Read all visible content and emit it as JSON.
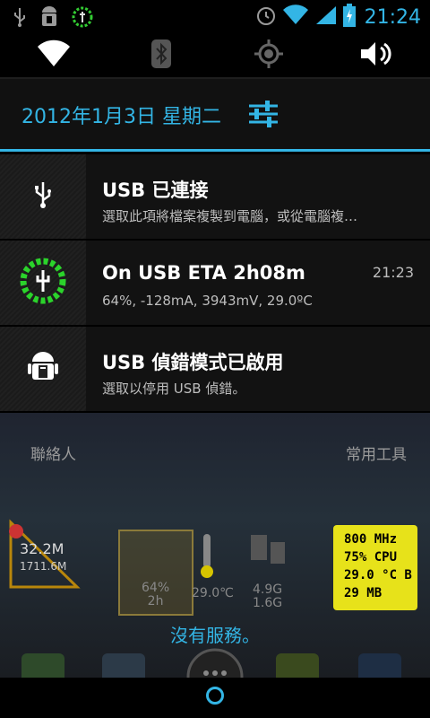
{
  "status_bar": {
    "time": "21:24",
    "left_icons": [
      "usb-icon",
      "android-debug-icon",
      "battery-widget-icon"
    ],
    "right_icons": [
      "alarm-icon",
      "wifi-icon",
      "signal-icon",
      "battery-charging-icon"
    ]
  },
  "quick_settings": {
    "items": [
      {
        "icon": "wifi-icon"
      },
      {
        "icon": "bluetooth-icon"
      },
      {
        "icon": "gps-icon"
      },
      {
        "icon": "volume-icon"
      }
    ]
  },
  "header": {
    "date": "2012年1月3日 星期二"
  },
  "notifications": [
    {
      "icon": "usb-icon",
      "title": "USB 已連接",
      "subtitle": "選取此項將檔案複製到電腦，或從電腦複…",
      "time": ""
    },
    {
      "icon": "battery-charge-ring-icon",
      "title": "On USB ETA 2h08m",
      "subtitle": "64%, -128mA, 3943mV, 29.0ºC",
      "time": "21:23"
    },
    {
      "icon": "android-debug-icon",
      "title": "USB 偵錯模式已啟用",
      "subtitle": "選取以停用 USB 偵錯。",
      "time": ""
    }
  ],
  "background": {
    "label_left": "聯絡人",
    "label_right": "常用工具",
    "signal_widget": {
      "line1": "32.2M",
      "line2": "1711.6M"
    },
    "battery_widget": {
      "line1": "64%",
      "line2": "2h"
    },
    "temp_widget": {
      "value": "29.0℃"
    },
    "storage_widget": {
      "line1": "4.9G",
      "line2": "1.6G"
    },
    "cpu_widget": {
      "l1": "800 MHz",
      "l2": "75% CPU",
      "l3": "29.0 °C B",
      "l4": "29 MB"
    },
    "no_service": "沒有服務。"
  },
  "colors": {
    "accent": "#33b5e5",
    "widget_yellow": "#e7e21a"
  }
}
